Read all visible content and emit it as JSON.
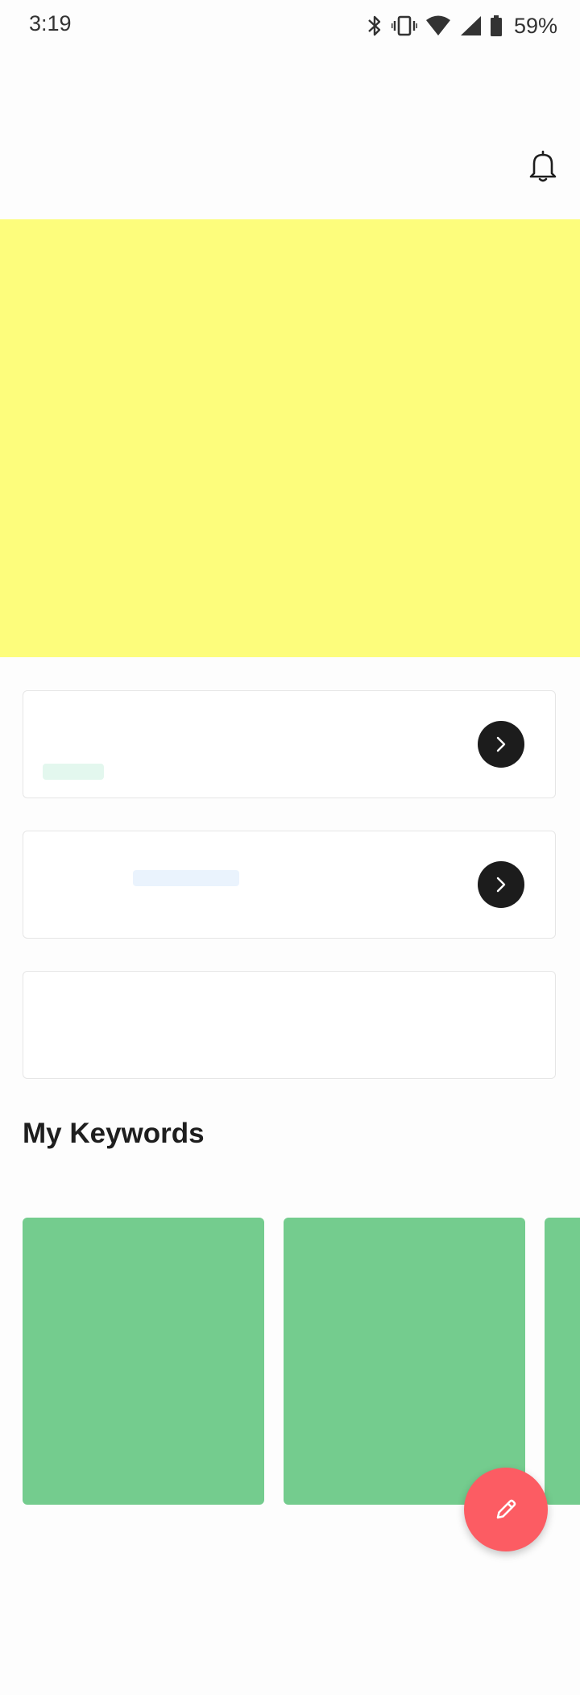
{
  "status_bar": {
    "time": "3:19",
    "battery_percent": "59%",
    "icons": [
      "bluetooth-icon",
      "vibrate-icon",
      "wifi-icon",
      "cell-signal-icon",
      "battery-icon"
    ]
  },
  "header": {
    "icons": [
      "bell-icon"
    ]
  },
  "colors": {
    "banner": "#fdfd7c",
    "keyword_card": "#74cc8e",
    "fab": "#fc5c63",
    "pill_green": "#e3f7ee",
    "pill_blue": "#eaf3fd",
    "arrow_button": "#1c1c1c"
  },
  "cards": [
    {
      "has_arrow": true,
      "placeholder": "pill_green"
    },
    {
      "has_arrow": true,
      "placeholder": "pill_blue"
    },
    {
      "has_arrow": false
    }
  ],
  "section": {
    "title": "My Keywords"
  },
  "fab": {
    "icon": "pencil-icon"
  }
}
